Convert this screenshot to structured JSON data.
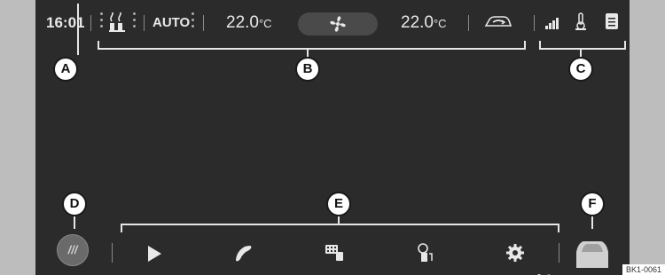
{
  "topbar": {
    "time": "16:01",
    "auto_label": "AUTO",
    "temp_left": "22.0",
    "temp_right": "22.0",
    "temp_unit": "°C"
  },
  "callouts": {
    "a": "A",
    "b": "B",
    "c": "C",
    "d": "D",
    "e": "E",
    "f": "F"
  },
  "bottombar": {
    "menu_icon_text": "///"
  },
  "icons": {
    "seat_heating": "seat-heating-icon",
    "fan": "fan-icon",
    "recirculation": "recirculation-icon",
    "signal": "signal-strength-icon",
    "thermometer": "thermometer-icon",
    "notes": "notes-icon",
    "play": "play-icon",
    "phone": "phone-icon",
    "keypad": "keypad-icon",
    "fuel": "fuel-icon",
    "settings": "gear-icon",
    "car": "car-icon"
  },
  "figure_ref": "BK1-0061",
  "colors": {
    "screen_bg": "#2b2b2b",
    "bezel": "#bdbdbd",
    "text": "#e8e8e8",
    "callout_bg": "#ffffff"
  }
}
